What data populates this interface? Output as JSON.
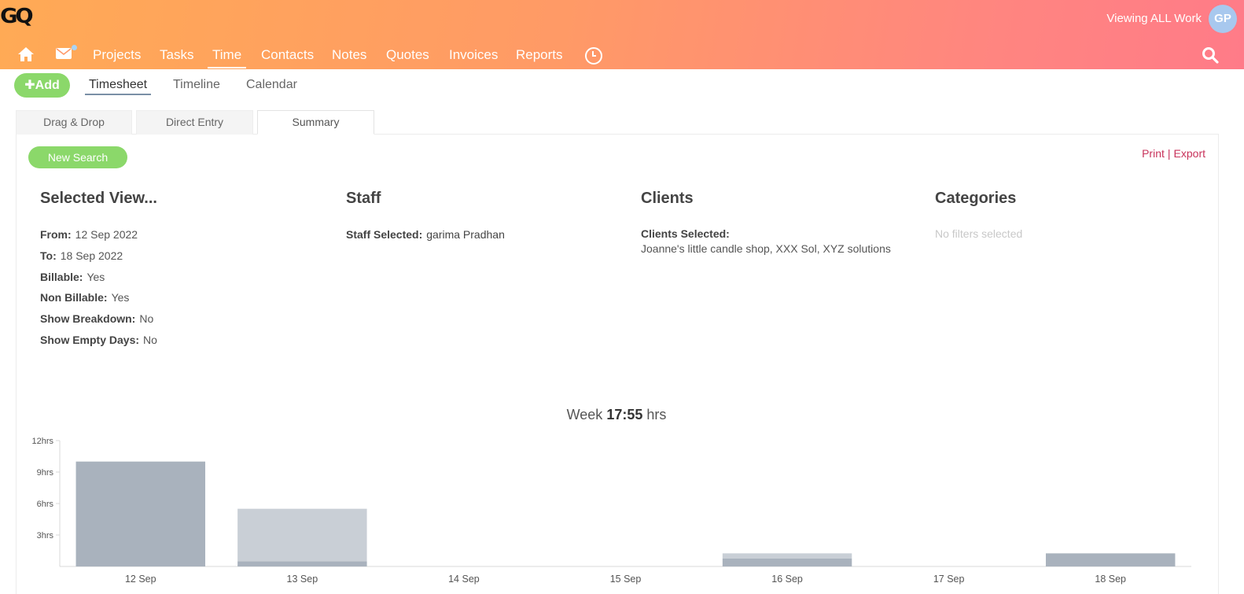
{
  "header": {
    "logo": "GQ",
    "viewing": "Viewing ALL Work",
    "avatar": "GP",
    "nav": [
      "Projects",
      "Tasks",
      "Time",
      "Contacts",
      "Notes",
      "Quotes",
      "Invoices",
      "Reports"
    ],
    "active_nav": "Time",
    "icons": [
      "home-icon",
      "mail-icon",
      "clock-icon",
      "search-icon"
    ]
  },
  "toolbar": {
    "add_label": "Add",
    "tabs": [
      "Timesheet",
      "Timeline",
      "Calendar"
    ],
    "active_tab": "Timesheet"
  },
  "panel_tabs": [
    "Drag & Drop",
    "Direct Entry",
    "Summary"
  ],
  "active_panel_tab": "Summary",
  "actions": {
    "new_search": "New Search",
    "print": "Print",
    "separator": "|",
    "export": "Export"
  },
  "selected_view": {
    "title": "Selected View...",
    "rows": [
      {
        "label": "From:",
        "value": "12 Sep 2022"
      },
      {
        "label": "To:",
        "value": "18 Sep 2022"
      },
      {
        "label": "Billable:",
        "value": "Yes"
      },
      {
        "label": "Non Billable:",
        "value": "Yes"
      },
      {
        "label": "Show Breakdown:",
        "value": "No"
      },
      {
        "label": "Show Empty Days:",
        "value": "No"
      }
    ]
  },
  "staff": {
    "title": "Staff",
    "label": "Staff Selected:",
    "value": "garima Pradhan"
  },
  "clients": {
    "title": "Clients",
    "label": "Clients Selected:",
    "value": "Joanne's little candle shop, XXX Sol, XYZ solutions"
  },
  "categories": {
    "title": "Categories",
    "value": "No filters selected"
  },
  "week_summary": {
    "prefix": "Week",
    "total": "17:55",
    "suffix": "hrs"
  },
  "colors": {
    "accent_green": "#8bd86a",
    "link_red": "#c8325a",
    "bar_dark": "#a9b2bd",
    "bar_light": "#c9cfd6"
  },
  "chart_data": {
    "type": "bar",
    "stacked": true,
    "categories": [
      "12 Sep",
      "13 Sep",
      "14 Sep",
      "15 Sep",
      "16 Sep",
      "17 Sep",
      "18 Sep"
    ],
    "series": [
      {
        "color": "#a9b2bd",
        "values": [
          10,
          0.5,
          0,
          0,
          0.75,
          0,
          1.25
        ]
      },
      {
        "color": "#c9cfd6",
        "values": [
          0,
          5,
          0,
          0,
          0.5,
          0,
          0
        ]
      }
    ],
    "yticks": [
      "3hrs",
      "6hrs",
      "9hrs",
      "12hrs"
    ],
    "ytick_values": [
      3,
      6,
      9,
      12
    ],
    "ylim": [
      0,
      12
    ]
  }
}
